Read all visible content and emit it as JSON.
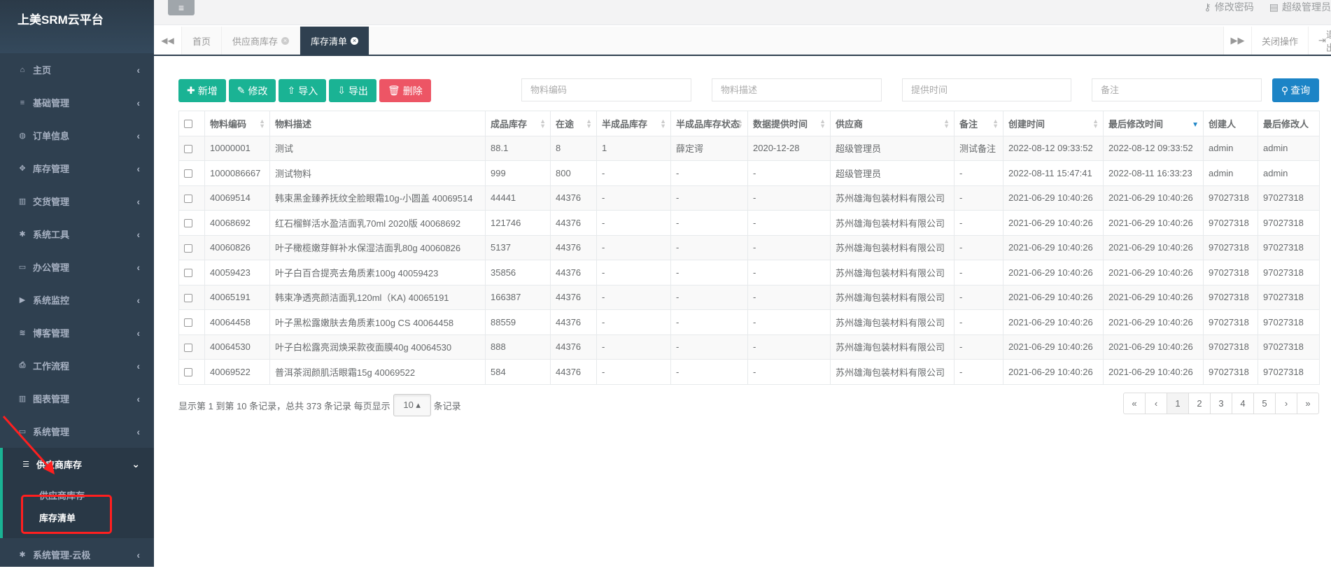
{
  "app": {
    "title": "上美SRM云平台"
  },
  "sidebar": {
    "items": [
      {
        "label": "主页",
        "icon": "home-icon",
        "glyph": "⌂"
      },
      {
        "label": "基础管理",
        "icon": "bars-icon",
        "glyph": "≡"
      },
      {
        "label": "订单信息",
        "icon": "globe-icon",
        "glyph": "◍"
      },
      {
        "label": "库存管理",
        "icon": "cubes-icon",
        "glyph": "✥"
      },
      {
        "label": "交货管理",
        "icon": "bar-chart-icon",
        "glyph": "▥"
      },
      {
        "label": "系统工具",
        "icon": "cog-icon",
        "glyph": "✱"
      },
      {
        "label": "办公管理",
        "icon": "laptop-icon",
        "glyph": "▭"
      },
      {
        "label": "系统监控",
        "icon": "video-icon",
        "glyph": "▶"
      },
      {
        "label": "博客管理",
        "icon": "rss-icon",
        "glyph": "≋"
      },
      {
        "label": "工作流程",
        "icon": "print-icon",
        "glyph": "⎙"
      },
      {
        "label": "图表管理",
        "icon": "bar-chart-icon",
        "glyph": "▥"
      },
      {
        "label": "系统管理",
        "icon": "desktop-icon",
        "glyph": "▭"
      }
    ],
    "active": {
      "label": "供应商库存",
      "icon": "database-icon",
      "glyph": "☰"
    },
    "subitems": [
      {
        "label": "供应商库存"
      },
      {
        "label": "库存清单"
      }
    ],
    "after": {
      "label": "系统管理-云极",
      "icon": "cog-icon",
      "glyph": "✱"
    }
  },
  "topbar": {
    "hamburger": "≡",
    "change_password": "修改密码",
    "user": "超级管理员"
  },
  "tabs": {
    "items": [
      {
        "label": "首页",
        "closable": false
      },
      {
        "label": "供应商库存",
        "closable": true
      },
      {
        "label": "库存清单",
        "closable": true
      }
    ],
    "close_ops": "关闭操作",
    "logout": "退出"
  },
  "toolbar": {
    "add": "新增",
    "edit": "修改",
    "import": "导入",
    "export": "导出",
    "delete": "删除"
  },
  "search": {
    "code_placeholder": "物料编码",
    "desc_placeholder": "物料描述",
    "time_placeholder": "提供时间",
    "remark_placeholder": "备注",
    "query": "查询"
  },
  "table": {
    "columns": [
      "物料编码",
      "物料描述",
      "成品库存",
      "在途",
      "半成品库存",
      "半成品库存状态",
      "数据提供时间",
      "供应商",
      "备注",
      "创建时间",
      "最后修改时间",
      "创建人",
      "最后修改人"
    ],
    "rows": [
      [
        "10000001",
        "测试",
        "88.1",
        "8",
        "1",
        "薛定谔",
        "2020-12-28",
        "超级管理员",
        "测试备注",
        "2022-08-12 09:33:52",
        "2022-08-12 09:33:52",
        "admin",
        "admin"
      ],
      [
        "1000086667",
        "测试物料",
        "999",
        "800",
        "-",
        "-",
        "-",
        "超级管理员",
        "-",
        "2022-08-11 15:47:41",
        "2022-08-11 16:33:23",
        "admin",
        "admin"
      ],
      [
        "40069514",
        "韩束黑金臻养抚纹全脸眼霜10g-小圆盖 40069514",
        "44441",
        "44376",
        "-",
        "-",
        "-",
        "苏州雄海包装材料有限公司",
        "-",
        "2021-06-29 10:40:26",
        "2021-06-29 10:40:26",
        "97027318",
        "97027318"
      ],
      [
        "40068692",
        "红石榴鲜活水盈洁面乳70ml 2020版 40068692",
        "121746",
        "44376",
        "-",
        "-",
        "-",
        "苏州雄海包装材料有限公司",
        "-",
        "2021-06-29 10:40:26",
        "2021-06-29 10:40:26",
        "97027318",
        "97027318"
      ],
      [
        "40060826",
        "叶子橄榄嫩芽鲜补水保湿洁面乳80g 40060826",
        "5137",
        "44376",
        "-",
        "-",
        "-",
        "苏州雄海包装材料有限公司",
        "-",
        "2021-06-29 10:40:26",
        "2021-06-29 10:40:26",
        "97027318",
        "97027318"
      ],
      [
        "40059423",
        "叶子白百合提亮去角质素100g 40059423",
        "35856",
        "44376",
        "-",
        "-",
        "-",
        "苏州雄海包装材料有限公司",
        "-",
        "2021-06-29 10:40:26",
        "2021-06-29 10:40:26",
        "97027318",
        "97027318"
      ],
      [
        "40065191",
        "韩束净透亮颜洁面乳120ml（KA) 40065191",
        "166387",
        "44376",
        "-",
        "-",
        "-",
        "苏州雄海包装材料有限公司",
        "-",
        "2021-06-29 10:40:26",
        "2021-06-29 10:40:26",
        "97027318",
        "97027318"
      ],
      [
        "40064458",
        "叶子黑松露嫩肤去角质素100g CS 40064458",
        "88559",
        "44376",
        "-",
        "-",
        "-",
        "苏州雄海包装材料有限公司",
        "-",
        "2021-06-29 10:40:26",
        "2021-06-29 10:40:26",
        "97027318",
        "97027318"
      ],
      [
        "40064530",
        "叶子白松露亮润焕采款夜面膜40g 40064530",
        "888",
        "44376",
        "-",
        "-",
        "-",
        "苏州雄海包装材料有限公司",
        "-",
        "2021-06-29 10:40:26",
        "2021-06-29 10:40:26",
        "97027318",
        "97027318"
      ],
      [
        "40069522",
        "普洱茶润颜肌活眼霜15g 40069522",
        "584",
        "44376",
        "-",
        "-",
        "-",
        "苏州雄海包装材料有限公司",
        "-",
        "2021-06-29 10:40:26",
        "2021-06-29 10:40:26",
        "97027318",
        "97027318"
      ]
    ]
  },
  "footer": {
    "info_prefix": "显示第 1 到第 10 条记录，总共 373 条记录 每页显示",
    "page_size": "10 ▴",
    "info_suffix": "条记录",
    "pages": [
      "«",
      "‹",
      "1",
      "2",
      "3",
      "4",
      "5",
      "›",
      "»"
    ],
    "current_page": "1"
  },
  "colors": {
    "sidebar_bg": "#2f4050",
    "accent_green": "#1ab394",
    "danger_red": "#ed5565",
    "query_blue": "#1c84c6",
    "annotation_red": "#ff1f1f"
  }
}
